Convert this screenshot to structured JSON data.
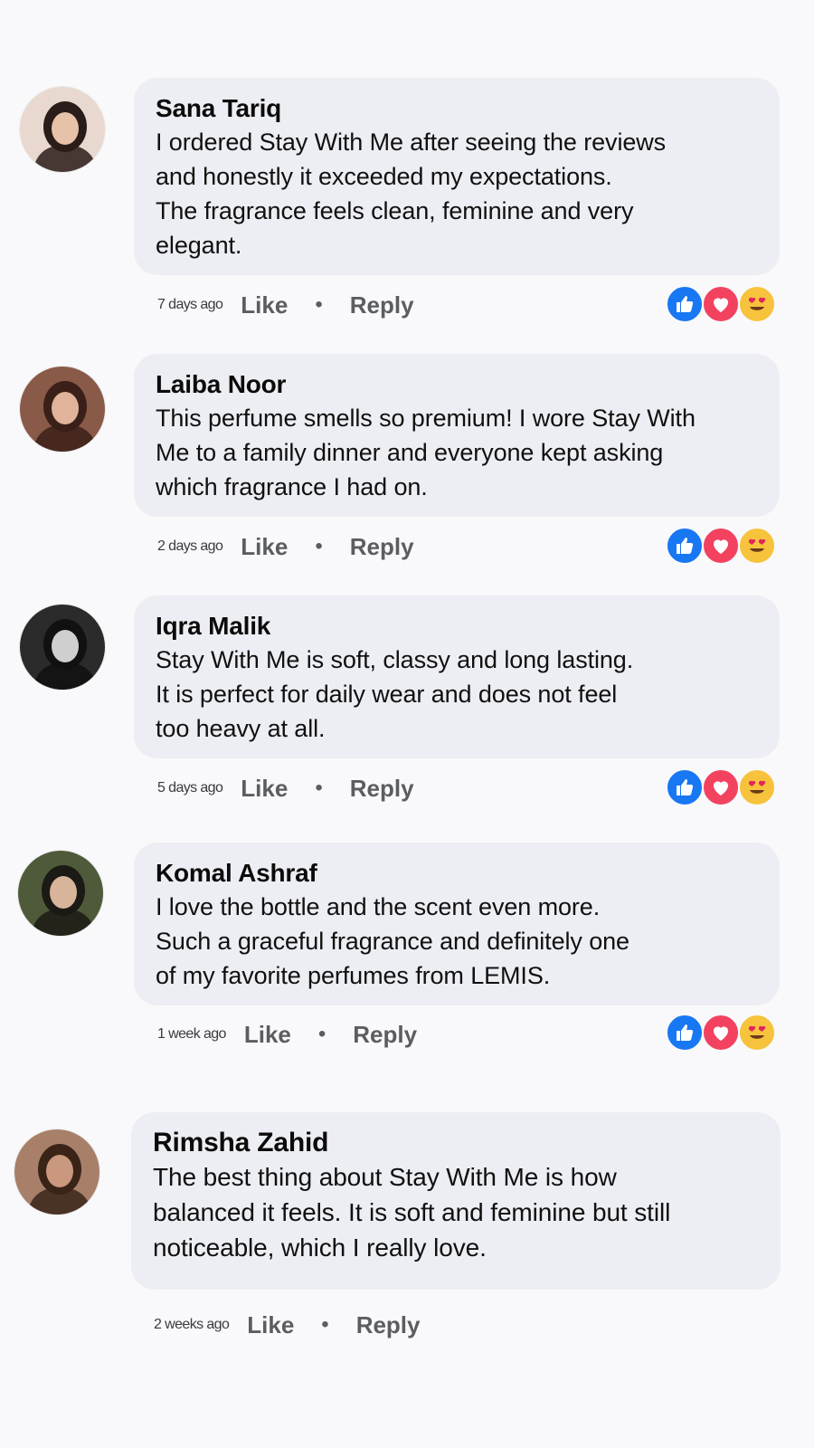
{
  "comments": [
    {
      "author": "Sana Tariq",
      "lines": [
        "I ordered Stay With Me after seeing the reviews",
        "and honestly it exceeded my expectations.",
        "The fragrance feels clean, feminine and very",
        "elegant."
      ],
      "time": "7 days ago",
      "like_label": "Like",
      "separator": "•",
      "reply_label": "Reply",
      "reactions": [
        "like-icon",
        "love-icon",
        "heart-eyes-icon"
      ],
      "avatar_bg": "#e9d8cf"
    },
    {
      "author": "Laiba Noor",
      "lines": [
        "This perfume smells so premium! I wore Stay With",
        "Me to a family dinner and everyone kept asking",
        "which fragrance I had on."
      ],
      "time": "2 days ago",
      "like_label": "Like",
      "separator": "•",
      "reply_label": "Reply",
      "reactions": [
        "like-icon",
        "love-icon",
        "heart-eyes-icon"
      ],
      "avatar_bg": "#8a5a48"
    },
    {
      "author": "Iqra Malik",
      "lines": [
        "Stay With Me is soft, classy and long lasting.",
        "It is perfect for daily wear and does not feel",
        "too heavy at all."
      ],
      "time": "5 days ago",
      "like_label": "Like",
      "separator": "•",
      "reply_label": "Reply",
      "reactions": [
        "like-icon",
        "love-icon",
        "heart-eyes-icon"
      ],
      "avatar_bg": "#2b2b2b"
    },
    {
      "author": "Komal Ashraf",
      "lines": [
        "I love the bottle and the scent even more.",
        "Such a graceful fragrance and definitely one",
        "of my favorite perfumes from LEMIS."
      ],
      "time": "1 week ago",
      "like_label": "Like",
      "separator": "•",
      "reply_label": "Reply",
      "reactions": [
        "like-icon",
        "love-icon",
        "heart-eyes-icon"
      ],
      "avatar_bg": "#4f5a3a"
    },
    {
      "author": "Rimsha Zahid",
      "lines": [
        "The best thing about Stay With Me is how",
        "balanced it feels. It is soft and feminine but still",
        "noticeable, which I really love."
      ],
      "time": "2 weeks ago",
      "like_label": "Like",
      "separator": "•",
      "reply_label": "Reply",
      "reactions": [],
      "avatar_bg": "#a8806a"
    }
  ],
  "colors": {
    "bubble": "#edeef3",
    "like_blue": "#1877f2",
    "love_red": "#f3425f",
    "wow_yellow": "#f7c33c"
  }
}
